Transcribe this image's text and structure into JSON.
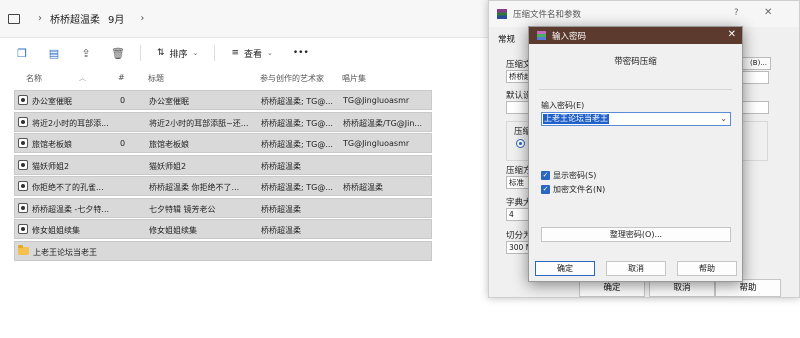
{
  "explorer": {
    "breadcrumb": [
      "桥桥超温柔",
      "9月"
    ],
    "toolbar": {
      "sort_label": "排序",
      "view_label": "查看",
      "more_label": "•••"
    },
    "columns": {
      "name": "名称",
      "number": "#",
      "title": "标题",
      "artists": "参与创作的艺术家",
      "album": "唱片集"
    },
    "files": [
      {
        "name": "办公室催眠",
        "number": "0",
        "title": "办公室催眠",
        "artists": "桥桥超温柔; TG@...",
        "album": "TG@Jingluoasmr"
      },
      {
        "name": "将近2小时的耳部添...",
        "number": "",
        "title": "将近2小时的耳部添舐~还...",
        "artists": "桥桥超温柔; TG@...",
        "album": "桥桥超温柔/TG@Jin..."
      },
      {
        "name": "旅馆老板娘",
        "number": "0",
        "title": "旅馆老板娘",
        "artists": "桥桥超温柔; TG@...",
        "album": "TG@Jingluoasmr"
      },
      {
        "name": "猫妖师姐2",
        "number": "",
        "title": "猫妖师姐2",
        "artists": "桥桥超温柔",
        "album": ""
      },
      {
        "name": "你拒绝不了的孔雀...",
        "number": "",
        "title": "桥桥超温柔  你拒绝不了...",
        "artists": "桥桥超温柔; TG@...",
        "album": "桥桥超温柔"
      },
      {
        "name": "桥桥超温柔 -七夕特...",
        "number": "",
        "title": "七夕特辑 镜芳老公",
        "artists": "桥桥超温柔",
        "album": ""
      },
      {
        "name": "修女姐姐续集",
        "number": "",
        "title": "修女姐姐续集",
        "artists": "桥桥超温柔",
        "album": ""
      }
    ],
    "folder": {
      "name": "上老王论坛当老王"
    }
  },
  "params_dialog": {
    "title": "压缩文件名和参数",
    "help_glyph": "?",
    "tab_general": "常规",
    "labels": [
      "压缩文",
      "默认设",
      "压缩",
      "压缩方",
      "字典大",
      "切分为"
    ],
    "field_values": [
      "桥桥超",
      "标准",
      "4",
      "300 M"
    ],
    "browse_label": "(B)...",
    "ok_label": "确定",
    "cancel_label": "取消",
    "help_label": "帮助"
  },
  "password_dialog": {
    "title": "输入密码",
    "heading": "带密码压缩",
    "password_label": "输入密码(E)",
    "password_value": "上老王论坛当老王",
    "show_password": "显示密码(S)",
    "encrypt_filenames": "加密文件名(N)",
    "manage_label": "整理密码(O)...",
    "ok_label": "确定",
    "cancel_label": "取消",
    "help_label": "帮助"
  },
  "colors": {
    "password_titlebar": "#5c3a2e",
    "selection": "#2060c8",
    "row_selected": "#d9d9d9",
    "accent": "#2a66c2"
  }
}
